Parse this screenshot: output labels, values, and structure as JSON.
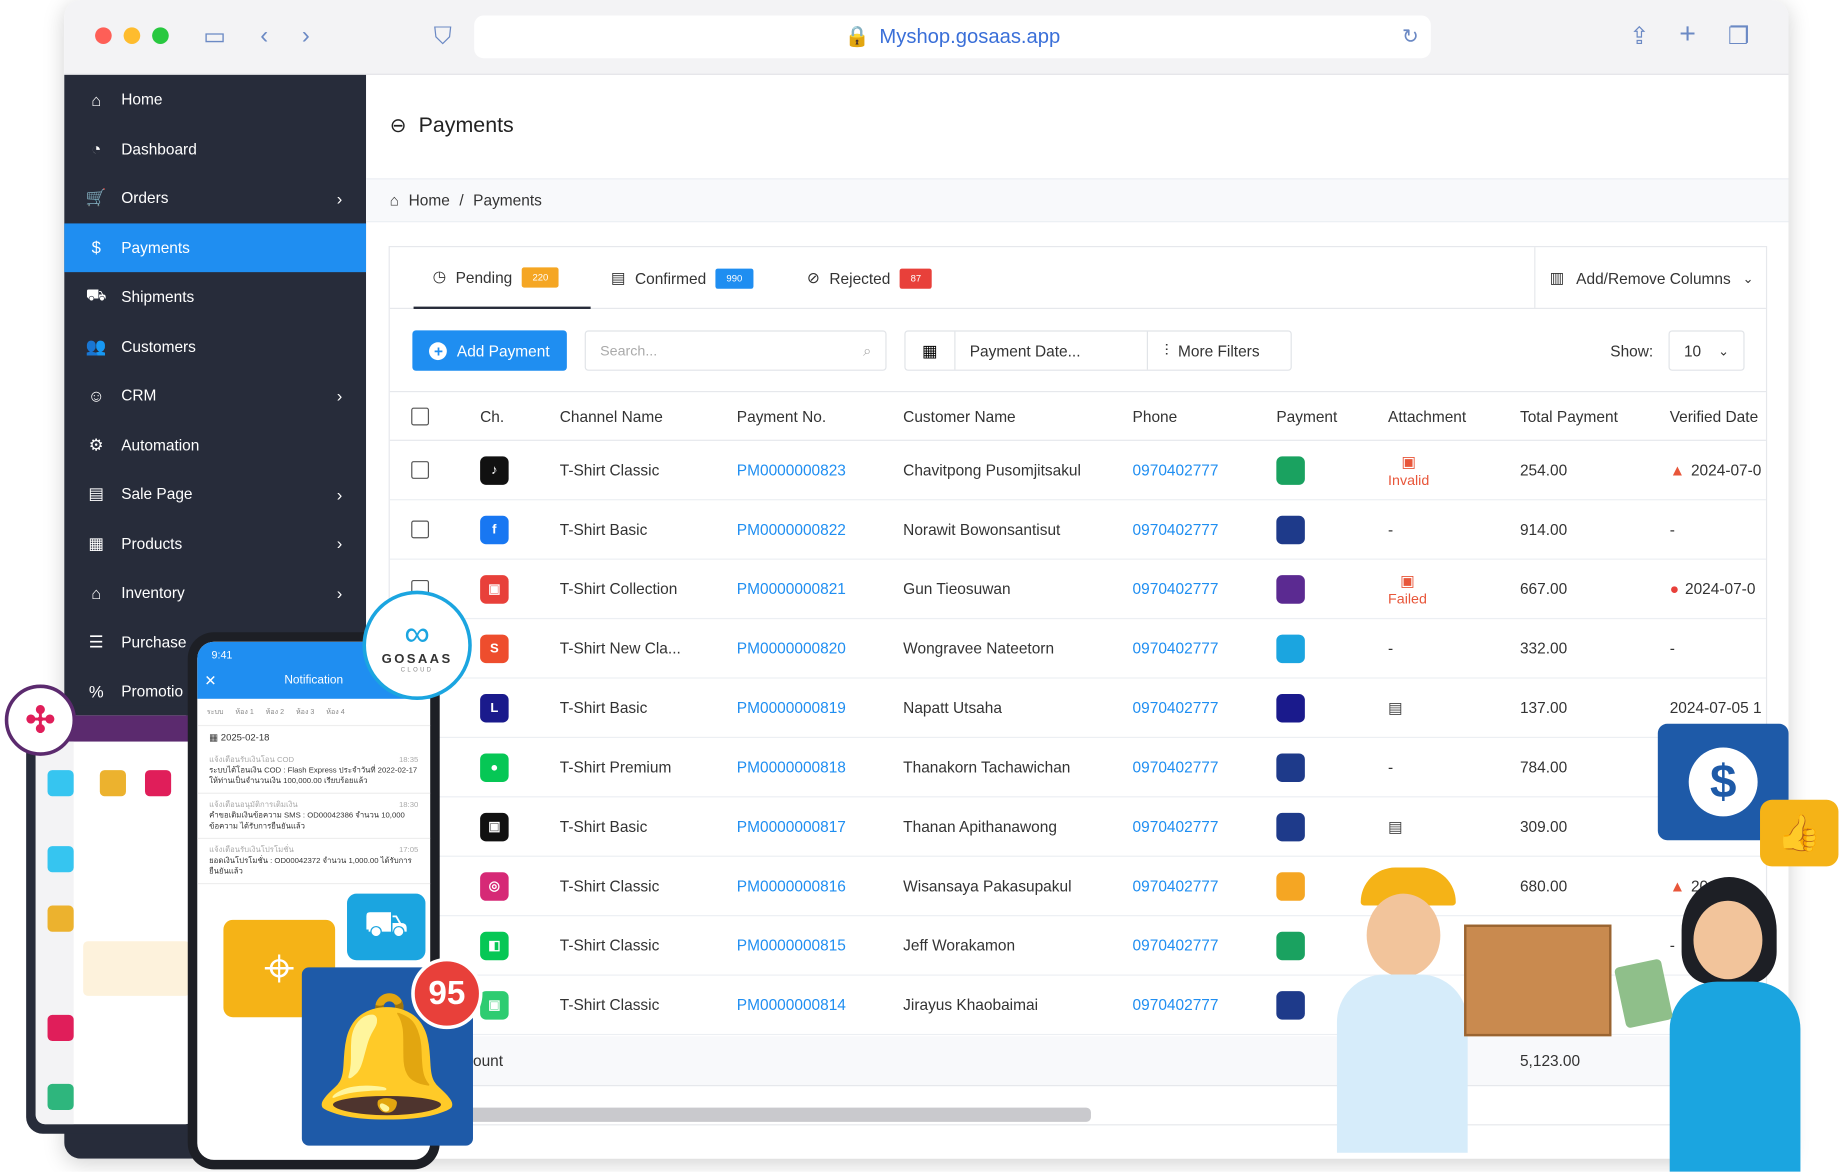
{
  "browser": {
    "url": "Myshop.gosaas.app"
  },
  "sidebar": {
    "items": [
      {
        "label": "Home",
        "icon": "home-icon",
        "glyph": "⌂",
        "chev": false,
        "active": false
      },
      {
        "label": "Dashboard",
        "icon": "dashboard-icon",
        "glyph": "◔",
        "chev": false,
        "active": false
      },
      {
        "label": "Orders",
        "icon": "cart-icon",
        "glyph": "🛒",
        "chev": true,
        "active": false
      },
      {
        "label": "Payments",
        "icon": "money-bag-icon",
        "glyph": "$",
        "chev": false,
        "active": true
      },
      {
        "label": "Shipments",
        "icon": "truck-icon",
        "glyph": "⛟",
        "chev": false,
        "active": false
      },
      {
        "label": "Customers",
        "icon": "users-icon",
        "glyph": "👥",
        "chev": false,
        "active": false
      },
      {
        "label": "CRM",
        "icon": "user-tie-icon",
        "glyph": "☺",
        "chev": true,
        "active": false
      },
      {
        "label": "Automation",
        "icon": "robot-icon",
        "glyph": "⚙",
        "chev": false,
        "active": false
      },
      {
        "label": "Sale Page",
        "icon": "window-icon",
        "glyph": "▤",
        "chev": true,
        "active": false
      },
      {
        "label": "Products",
        "icon": "boxes-icon",
        "glyph": "▦",
        "chev": true,
        "active": false
      },
      {
        "label": "Inventory",
        "icon": "warehouse-icon",
        "glyph": "⌂",
        "chev": true,
        "active": false
      },
      {
        "label": "Purchase",
        "icon": "pallet-icon",
        "glyph": "☰",
        "chev": false,
        "active": false
      },
      {
        "label": "Promotio",
        "icon": "percent-icon",
        "glyph": "%",
        "chev": false,
        "active": false
      }
    ]
  },
  "page": {
    "title": "Payments",
    "breadcrumb": {
      "home": "Home",
      "sep": "/",
      "current": "Payments"
    }
  },
  "tabs": [
    {
      "label": "Pending",
      "count": "220",
      "color": "#f5a623",
      "glyph": "◷",
      "icon": "clock-icon"
    },
    {
      "label": "Confirmed",
      "count": "990",
      "color": "#1f8ef1",
      "glyph": "▤",
      "icon": "file-check-icon"
    },
    {
      "label": "Rejected",
      "count": "87",
      "color": "#e8403a",
      "glyph": "⊘",
      "icon": "ban-icon"
    }
  ],
  "toolbar": {
    "columns_label": "Add/Remove Columns",
    "add_payment": "Add Payment",
    "search_placeholder": "Search...",
    "payment_date": "Payment Date...",
    "more_filters": "More Filters",
    "show_label": "Show:",
    "show_value": "10"
  },
  "table": {
    "columns": [
      "Ch.",
      "Channel Name",
      "Payment No.",
      "Customer Name",
      "Phone",
      "Payment",
      "Attachment",
      "Total Payment",
      "Verified Date"
    ],
    "rows": [
      {
        "ch_color": "#111",
        "ch_glyph": "♪",
        "ch_icon": "tiktok-icon",
        "channel": "T-Shirt Classic",
        "payment_no": "PM0000000823",
        "customer": "Chavitpong Pusomjitsakul",
        "phone": "0970402777",
        "pay_color": "#1aa260",
        "pay_icon": "kbank-icon",
        "attach": "Invalid",
        "attach_type": "badfile",
        "total": "254.00",
        "verified": "2024-07-0",
        "v_icon": "warn"
      },
      {
        "ch_color": "#1877f2",
        "ch_glyph": "f",
        "ch_icon": "facebook-icon",
        "channel": "T-Shirt Basic",
        "payment_no": "PM0000000822",
        "customer": "Norawit Bowonsantisut",
        "phone": "0970402777",
        "pay_color": "#1e3a8a",
        "pay_icon": "cod-truck-icon",
        "attach": "-",
        "attach_type": "text",
        "total": "914.00",
        "verified": "-",
        "v_icon": ""
      },
      {
        "ch_color": "#e8403a",
        "ch_glyph": "▣",
        "ch_icon": "store-icon",
        "channel": "T-Shirt Collection",
        "payment_no": "PM0000000821",
        "customer": "Gun Tieosuwan",
        "phone": "0970402777",
        "pay_color": "#5b2a91",
        "pay_icon": "scb-icon",
        "attach": "Failed",
        "attach_type": "badfile",
        "total": "667.00",
        "verified": "2024-07-0",
        "v_icon": "err"
      },
      {
        "ch_color": "#ee4d2d",
        "ch_glyph": "S",
        "ch_icon": "shopee-icon",
        "channel": "T-Shirt New Cla...",
        "payment_no": "PM0000000820",
        "customer": "Wongravee Nateetorn",
        "phone": "0970402777",
        "pay_color": "#1ba5e0",
        "pay_icon": "ktb-icon",
        "attach": "-",
        "attach_type": "text",
        "total": "332.00",
        "verified": "-",
        "v_icon": ""
      },
      {
        "ch_color": "#1a1a8c",
        "ch_glyph": "L",
        "ch_icon": "lazada-icon",
        "channel": "T-Shirt Basic",
        "payment_no": "PM0000000819",
        "customer": "Napatt Utsaha",
        "phone": "0970402777",
        "pay_color": "#1a1a8c",
        "pay_icon": "lazada-pay-icon",
        "attach": "",
        "attach_type": "file",
        "total": "137.00",
        "verified": "2024-07-05 1",
        "v_icon": ""
      },
      {
        "ch_color": "#06c755",
        "ch_glyph": "●",
        "ch_icon": "line-icon",
        "channel": "T-Shirt Premium",
        "payment_no": "PM0000000818",
        "customer": "Thanakorn Tachawichan",
        "phone": "0970402777",
        "pay_color": "#1e3a8a",
        "pay_icon": "cod-truck-icon",
        "attach": "-",
        "attach_type": "text",
        "total": "784.00",
        "verified": "-",
        "v_icon": ""
      },
      {
        "ch_color": "#111",
        "ch_glyph": "▣",
        "ch_icon": "bag-icon",
        "channel": "T-Shirt Basic",
        "payment_no": "PM0000000817",
        "customer": "Thanan Apithanawong",
        "phone": "0970402777",
        "pay_color": "#1e3a8a",
        "pay_icon": "promptpay-icon",
        "attach": "",
        "attach_type": "file",
        "total": "309.00",
        "verified": "",
        "v_icon": ""
      },
      {
        "ch_color": "#d62976",
        "ch_glyph": "◎",
        "ch_icon": "instagram-icon",
        "channel": "T-Shirt Classic",
        "payment_no": "PM0000000816",
        "customer": "Wisansaya Pakasupakul",
        "phone": "0970402777",
        "pay_color": "#f5a623",
        "pay_icon": "krungsri-icon",
        "attach": "",
        "attach_type": "",
        "total": "680.00",
        "verified": "20",
        "v_icon": "warn"
      },
      {
        "ch_color": "#06c755",
        "ch_glyph": "◧",
        "ch_icon": "line-shop-icon",
        "channel": "T-Shirt Classic",
        "payment_no": "PM0000000815",
        "customer": "Jeff Worakamon",
        "phone": "0970402777",
        "pay_color": "#1aa260",
        "pay_icon": "kbank-icon",
        "attach": "",
        "attach_type": "",
        "total": "",
        "verified": "-",
        "v_icon": ""
      },
      {
        "ch_color": "#2ecc71",
        "ch_glyph": "▣",
        "ch_icon": "shop-bag-icon",
        "channel": "T-Shirt Classic",
        "payment_no": "PM0000000814",
        "customer": "Jirayus Khaobaimai",
        "phone": "0970402777",
        "pay_color": "#1e3a8a",
        "pay_icon": "cod-truck-icon",
        "attach": "",
        "attach_type": "",
        "total": "",
        "verified": "",
        "v_icon": ""
      }
    ],
    "footer": {
      "label": "ount",
      "total": "5,123.00"
    }
  },
  "phone": {
    "time": "9:41",
    "title": "Notification",
    "tabs": [
      "ระบบ",
      "ห้อง 1",
      "ห้อง 2",
      "ห้อง 3",
      "ห้อง 4"
    ],
    "date": "2025-02-18",
    "notes": [
      {
        "head": "แจ้งเตือนรับเงินโอน COD",
        "time": "18:35",
        "body": "ระบบได้โอนเงิน COD : Flash Express ประจำวันที่ 2022-02-17 ให้ท่านเป็นจำนวนเงิน 100,000.00 เรียบร้อยแล้ว"
      },
      {
        "head": "แจ้งเตือนอนุมัติการเติมเงิน",
        "time": "18:30",
        "body": "คำขอเติมเงินข้อความ SMS : OD00042386 จำนวน 10,000 ข้อความ ได้รับการยืนยันแล้ว"
      },
      {
        "head": "แจ้งเตือนรับเงินโปรโมชั่น",
        "time": "17:05",
        "body": "ยอดเงินโปรโมชั่น : OD00042372 จำนวน 1,000.00 ได้รับการยืนยันแล้ว"
      }
    ]
  },
  "brand": {
    "name": "GOSAAS",
    "sub": "CLOUD"
  },
  "bell_count": "95"
}
